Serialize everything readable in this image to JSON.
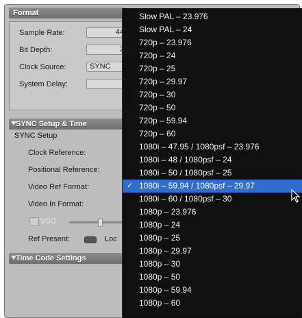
{
  "format": {
    "header": "Format",
    "sample_rate_label": "Sample Rate:",
    "sample_rate_value": "44",
    "bit_depth_label": "Bit Depth:",
    "bit_depth_value": "2",
    "clock_source_label": "Clock Source:",
    "clock_source_value": "SYNC",
    "system_delay_label": "System Delay:",
    "system_delay_value": ""
  },
  "sync": {
    "header": "SYNC Setup & Time",
    "subhead": "SYNC Setup",
    "clock_reference_label": "Clock Reference:",
    "positional_reference_label": "Positional Reference:",
    "video_ref_format_label": "Video Ref Format:",
    "video_in_format_label": "Video In Format:",
    "vso_label": "VSO",
    "ref_present_label": "Ref Present:",
    "lock_label": "Loc"
  },
  "timecode": {
    "header": "Time Code Settings"
  },
  "menu": {
    "items": [
      "Slow PAL – 23.976",
      "Slow PAL – 24",
      "720p – 23.976",
      "720p – 24",
      "720p – 25",
      "720p – 29.97",
      "720p – 30",
      "720p – 50",
      "720p – 59.94",
      "720p – 60",
      "1080i – 47.95 / 1080psf – 23.976",
      "1080i – 48 / 1080psf – 24",
      "1080i – 50 / 1080psf – 25",
      "1080i – 59.94 / 1080psf – 29.97",
      "1080i – 60 / 1080psf – 30",
      "1080p – 23.976",
      "1080p – 24",
      "1080p – 25",
      "1080p – 29.97",
      "1080p – 30",
      "1080p – 50",
      "1080p – 59.94",
      "1080p – 60"
    ],
    "selected_index": 13,
    "check_glyph": "✓",
    "selected_color": "#2f6dcf"
  }
}
